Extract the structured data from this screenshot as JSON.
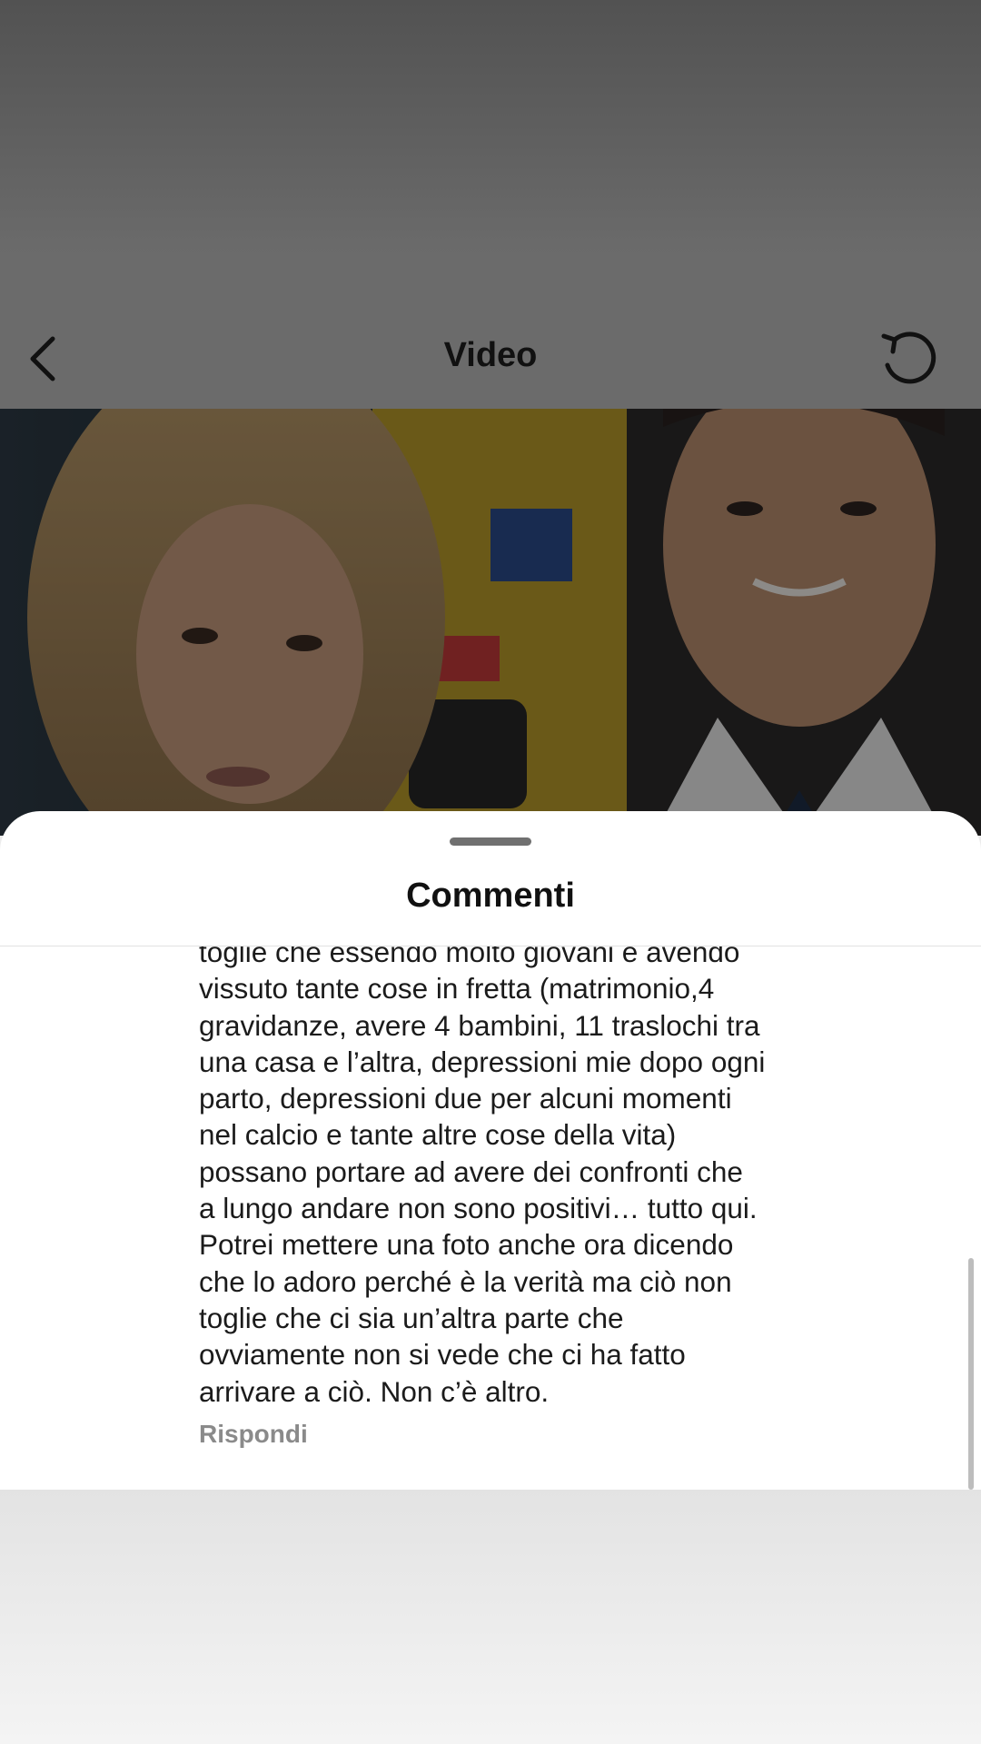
{
  "header": {
    "title": "Video",
    "back_icon": "chevron-left-icon",
    "replay_icon": "rotate-ccw-icon"
  },
  "comments_sheet": {
    "title": "Commenti",
    "comment_text": "toglie che essendo molto giovani e avendo\nvissuto tante cose in fretta (matrimonio,4\ngravidanze, avere 4 bambini, 11 traslochi tra\nuna casa e l’altra, depressioni mie dopo ogni\nparto, depressioni due per alcuni momenti\nnel calcio e tante altre cose della vita)\npossano portare ad avere dei confronti che\na lungo andare non sono positivi… tutto qui.\nPotrei mettere una foto anche ora dicendo\nche lo adoro perché è la verità ma ciò non\ntoglie che ci sia un’altra parte che\novviamente non si vede che ci ha fatto\narrivare a ciò. Non c’è altro.",
    "reply_label": "Rispondi"
  },
  "colors": {
    "overlay": "#6b6b6b",
    "sheet_background": "#ffffff",
    "text": "#1b1b1b",
    "secondary_text": "#8a8a8a"
  }
}
